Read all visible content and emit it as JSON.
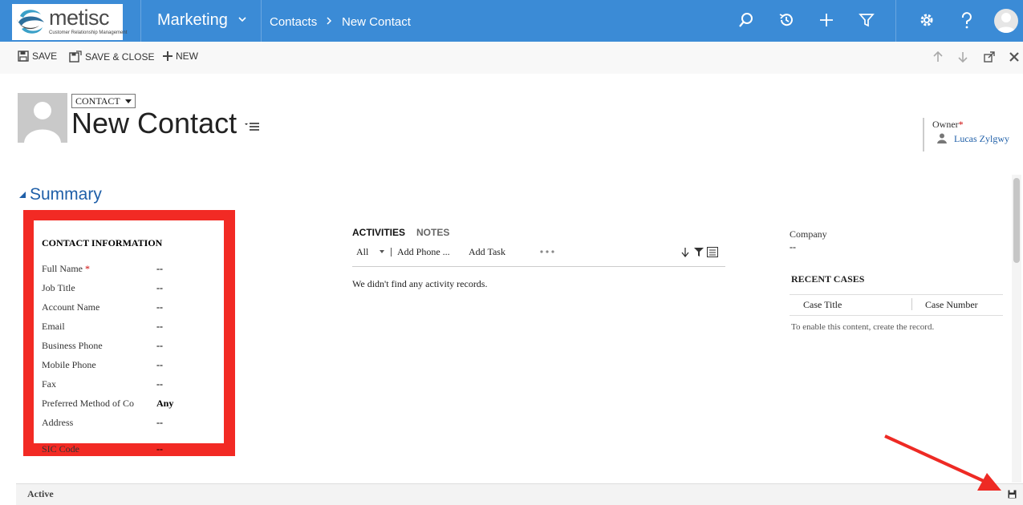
{
  "topbar": {
    "logo_brand": "metisc",
    "logo_tagline": "Customer Relationship Management",
    "area": "Marketing",
    "breadcrumb": [
      "Contacts",
      "New Contact"
    ]
  },
  "commands": {
    "save": "SAVE",
    "save_close": "SAVE & CLOSE",
    "new": "NEW"
  },
  "header": {
    "entity": "CONTACT",
    "title": "New Contact",
    "owner_label": "Owner",
    "owner_required": "*",
    "owner_value": "Lucas Zylgwy"
  },
  "section": {
    "title": "Summary"
  },
  "contact_info": {
    "heading": "CONTACT INFORMATION",
    "fields": [
      {
        "label": "Full Name",
        "required": "*",
        "value": "--"
      },
      {
        "label": "Job Title",
        "value": "--"
      },
      {
        "label": "Account Name",
        "value": "--"
      },
      {
        "label": "Email",
        "value": "--"
      },
      {
        "label": "Business Phone",
        "value": "--"
      },
      {
        "label": "Mobile Phone",
        "value": "--"
      },
      {
        "label": "Fax",
        "value": "--"
      },
      {
        "label": "Preferred Method of Co",
        "value": "Any"
      },
      {
        "label": "Address",
        "value": "--"
      },
      {
        "label": "SIC Code",
        "value": "--"
      }
    ]
  },
  "activities": {
    "tab_activities": "ACTIVITIES",
    "tab_notes": "NOTES",
    "filter": "All",
    "add_phone": "Add Phone ...",
    "add_task": "Add Task",
    "empty": "We didn't find any activity records."
  },
  "right": {
    "company_label": "Company",
    "company_value": "--",
    "cases_title": "RECENT CASES",
    "col_title": "Case Title",
    "col_number": "Case Number",
    "cases_empty": "To enable this content, create the record."
  },
  "footer": {
    "status": "Active"
  },
  "colors": {
    "topbar": "#3b8bd6",
    "link": "#1f5fa8",
    "highlight": "#f22a24",
    "annotation_arrow": "#ee2a24"
  }
}
